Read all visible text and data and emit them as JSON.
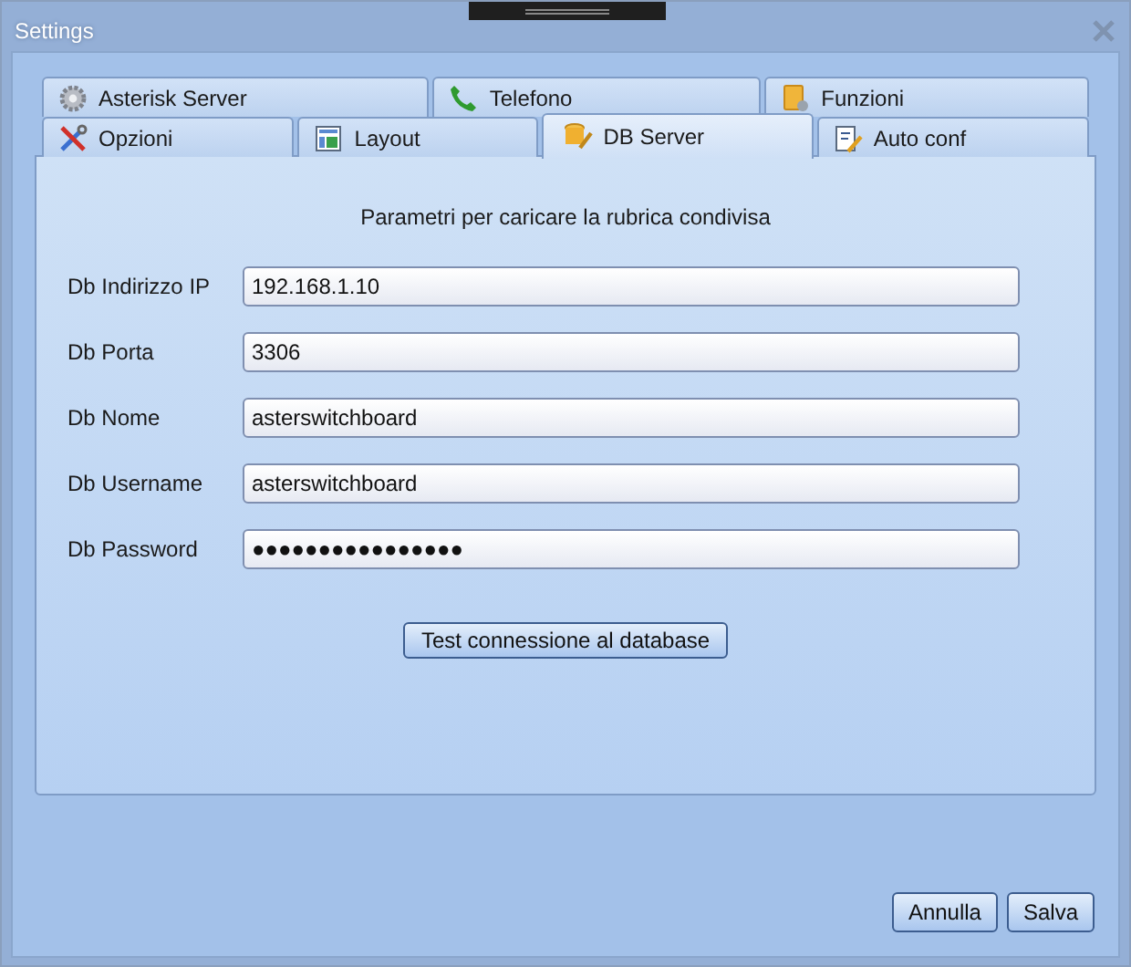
{
  "window": {
    "title": "Settings"
  },
  "tab_rows": [
    [
      {
        "label": "Asterisk Server",
        "selected": false
      },
      {
        "label": "Telefono",
        "selected": false
      },
      {
        "label": "Funzioni",
        "selected": false
      }
    ],
    [
      {
        "label": "Opzioni",
        "selected": false
      },
      {
        "label": "Layout",
        "selected": false
      },
      {
        "label": "DB Server",
        "selected": true
      },
      {
        "label": "Auto conf",
        "selected": false
      }
    ]
  ],
  "heading": "Parametri per caricare la rubrica condivisa",
  "fields": [
    {
      "label": "Db Indirizzo IP",
      "value": "192.168.1.10"
    },
    {
      "label": "Db Porta",
      "value": "3306"
    },
    {
      "label": "Db Nome",
      "value": "asterswitchboard"
    },
    {
      "label": "Db Username",
      "value": "asterswitchboard"
    },
    {
      "label": "Db Password",
      "value": "●●●●●●●●●●●●●●●●"
    }
  ],
  "test_button": "Test  connessione al database",
  "buttons": [
    "Annulla",
    "Salva"
  ]
}
